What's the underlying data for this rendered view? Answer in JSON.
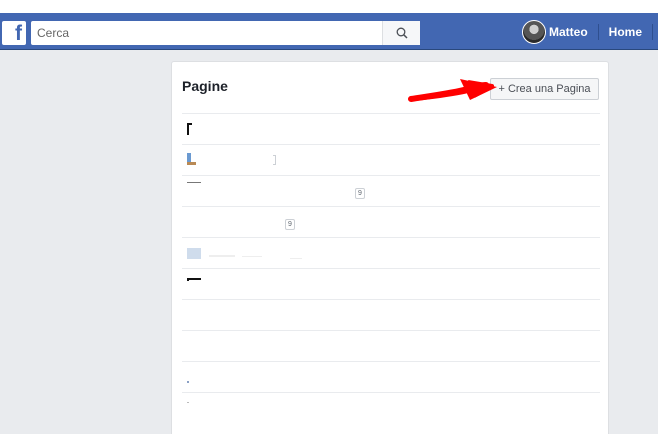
{
  "topbar": {
    "logo_letter": "f",
    "search_placeholder": "Cerca",
    "user_name": "Matteo",
    "home_label": "Home",
    "colors": {
      "bar": "#4267b2",
      "page_bg": "#e9ebee"
    }
  },
  "pages_panel": {
    "title": "Pagine",
    "create_button_label": "+ Crea una Pagina",
    "rows": [
      {
        "badge": ""
      },
      {
        "badge": ""
      },
      {
        "badge": "9"
      },
      {
        "badge": "9"
      },
      {
        "badge": ""
      },
      {
        "badge": ""
      },
      {
        "badge": ""
      },
      {
        "badge": ""
      },
      {
        "badge": ""
      },
      {
        "badge": ""
      }
    ]
  },
  "annotation": {
    "color": "#ff0000",
    "icon": "red-arrow"
  },
  "icons": {
    "search": "magnifier-icon",
    "create": "plus"
  }
}
